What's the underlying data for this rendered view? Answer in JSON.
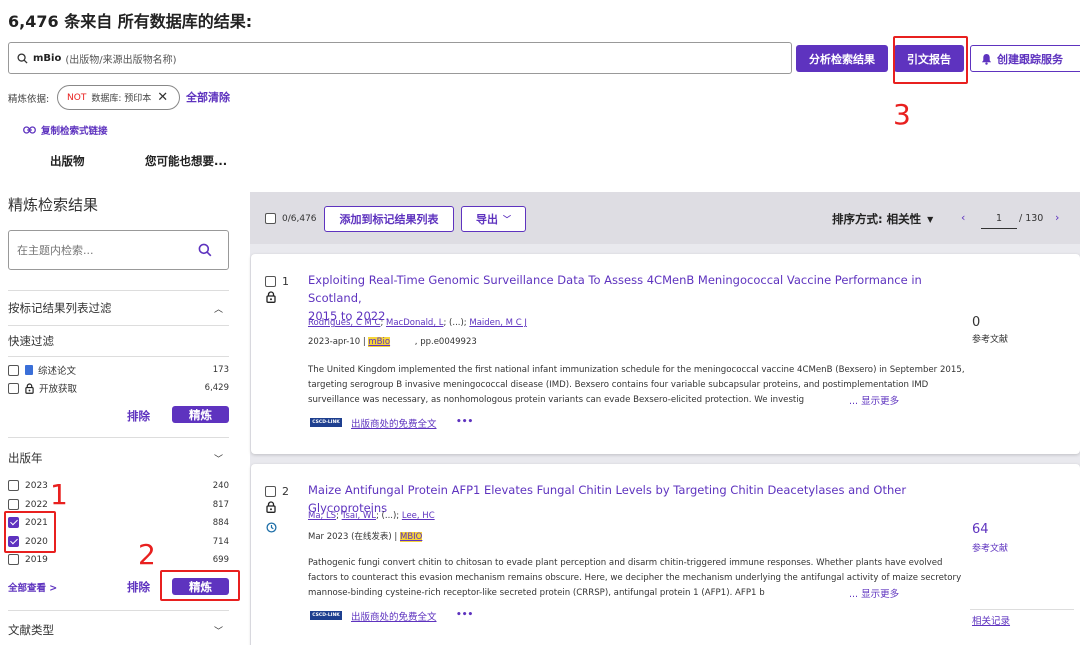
{
  "header": {
    "result_count": "6,476",
    "result_text": "条来自 所有数据库的结果:"
  },
  "search": {
    "query": "mBio",
    "query_hint": "(出版物/来源出版物名称)",
    "analyze_label": "分析检索结果",
    "citation_report_label": "引文报告",
    "alert_label": "创建跟踪服务"
  },
  "refine_bar": {
    "label": "精炼依据:",
    "chip_not": "NOT",
    "chip_text": "数据库: 预印本",
    "clear_all": "全部清除",
    "copy_link": "复制检索式链接"
  },
  "tabs": {
    "publication": "出版物",
    "you_may_like": "您可能也想要..."
  },
  "sidebar": {
    "title": "精炼检索结果",
    "search_placeholder": "在主题内检索...",
    "marked_filter": "按标记结果列表过滤",
    "quick_filter": "快速过滤",
    "quick_items": [
      {
        "label": "综述论文",
        "count": "173"
      },
      {
        "label": "开放获取",
        "count": "6,429"
      }
    ],
    "exclude": "排除",
    "refine": "精炼",
    "year_title": "出版年",
    "years": [
      {
        "label": "2023",
        "count": "240",
        "checked": false
      },
      {
        "label": "2022",
        "count": "817",
        "checked": false
      },
      {
        "label": "2021",
        "count": "884",
        "checked": true
      },
      {
        "label": "2020",
        "count": "714",
        "checked": true
      },
      {
        "label": "2019",
        "count": "699",
        "checked": false
      }
    ],
    "see_all": "全部查看 >",
    "doc_type_title": "文献类型"
  },
  "toolbar": {
    "selected": "0/6,476",
    "add_to_marked": "添加到标记结果列表",
    "export": "导出",
    "sort_label": "排序方式: 相关性",
    "page_current": "1",
    "page_total": "/ 130"
  },
  "results": [
    {
      "index": "1",
      "title_line1": "Exploiting Real-Time Genomic Surveillance Data To Assess 4CMenB Meningococcal Vaccine Performance in Scotland,",
      "title_line2": "2015 to 2022.",
      "authors": [
        "Rodrigues, C M C",
        "MacDonald, L",
        "Maiden, M C J"
      ],
      "authors_sep1": ";",
      "authors_sep2": "; (...);",
      "date": "2023-apr-10 |",
      "journal": "mBio",
      "pages": ", pp.e0049923",
      "abstract_1": "The United Kingdom implemented the first national infant immunization schedule for the meningococcal vaccine 4CMenB (Bexsero) in September 2015,",
      "abstract_2": "targeting serogroup B invasive meningococcal disease (IMD). Bexsero contains four variable subcapsular proteins, and postimplementation IMD",
      "abstract_3": "surveillance was necessary, as nonhomologous protein variants can evade Bexsero-elicited protection. We investig",
      "show_more": "... 显示更多",
      "full_text": "出版商处的免费全文",
      "citations": "0",
      "citations_label": "参考文献"
    },
    {
      "index": "2",
      "title_line1": "Maize Antifungal Protein AFP1 Elevates Fungal Chitin Levels by Targeting Chitin Deacetylases and Other Glycoproteins",
      "authors": [
        "Ma, LS",
        "Tsai, WL",
        "Lee, HC"
      ],
      "authors_sep1": ";",
      "authors_sep2": "; (...);",
      "date": "Mar 2023 (在线发表) |",
      "journal": "MBIO",
      "abstract_1": "Pathogenic fungi convert chitin to chitosan to evade plant perception and disarm chitin-triggered immune responses. Whether plants have evolved",
      "abstract_2": "factors to counteract this evasion mechanism remains obscure. Here, we decipher the mechanism underlying the antifungal activity of maize secretory",
      "abstract_3": "mannose-binding cysteine-rich receptor-like secreted protein (CRRSP), antifungal protein 1 (AFP1). AFP1 b",
      "show_more": "... 显示更多",
      "full_text": "出版商处的免费全文",
      "citations": "64",
      "citations_label": "参考文献",
      "related": "相关记录"
    }
  ],
  "badge": "CSCD-LINK",
  "more_dots": "•••",
  "annotations": [
    "1",
    "2",
    "3"
  ],
  "colors": {
    "accent": "#5e33bf",
    "annotation": "#e8201f",
    "highlight": "#f5d53a"
  }
}
